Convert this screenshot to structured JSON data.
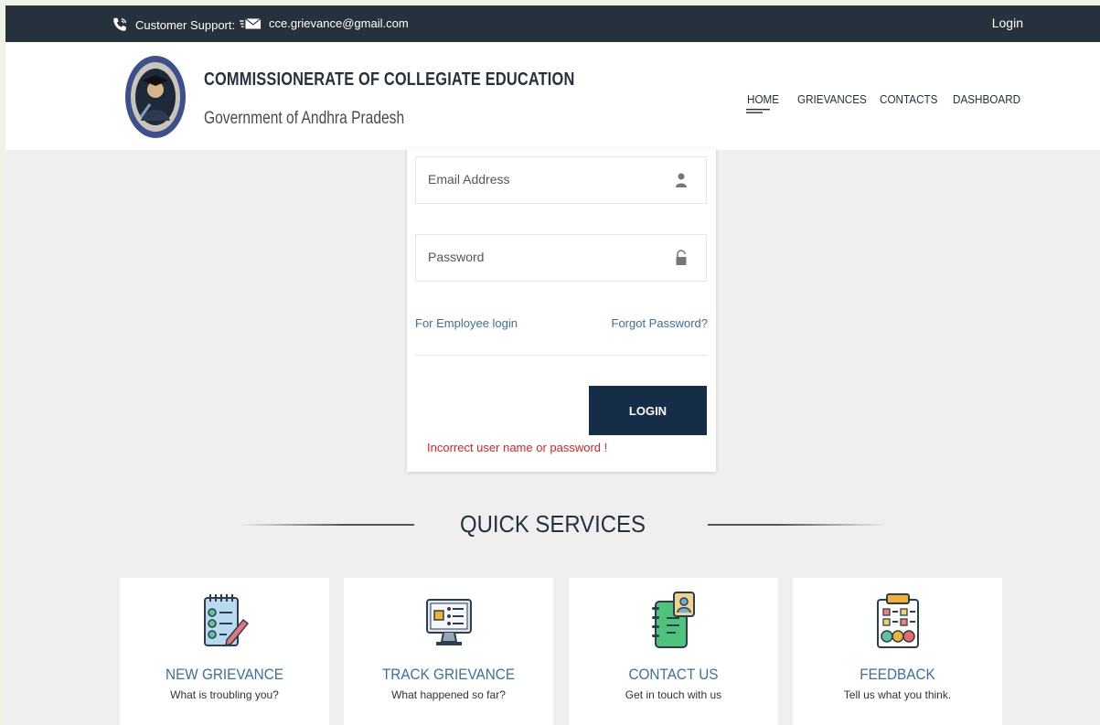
{
  "topbar": {
    "support_label": "Customer Support:",
    "email": "cce.grievance@gmail.com",
    "login_label": "Login"
  },
  "header": {
    "org_title": "COMMISSIONERATE OF COLLEGIATE EDUCATION",
    "org_subtitle": "Government of Andhra Pradesh",
    "nav": [
      "HOME",
      "GRIEVANCES",
      "CONTACTS",
      "DASHBOARD"
    ]
  },
  "login_form": {
    "email_placeholder": "Email Address",
    "password_placeholder": "Password",
    "employee_link": "For Employee login",
    "forgot_link": "Forgot Password?",
    "login_button": "LOGIN",
    "error_message": "Incorrect user name or password !"
  },
  "quick_services": {
    "title": "QUICK SERVICES",
    "items": [
      {
        "title": "NEW GRIEVANCE",
        "desc": "What is troubling you?",
        "icon": "checklist-pen-icon"
      },
      {
        "title": "TRACK GRIEVANCE",
        "desc": "What happened so far?",
        "icon": "monitor-list-icon"
      },
      {
        "title": "CONTACT US",
        "desc": "Get in touch with us",
        "icon": "contact-book-icon"
      },
      {
        "title": "FEEDBACK",
        "desc": "Tell us what you think.",
        "icon": "feedback-clipboard-icon"
      }
    ]
  },
  "colors": {
    "topbar_bg": "#25313d",
    "button_bg": "#162d48",
    "link": "#3c6f9e",
    "error": "#e02020"
  }
}
